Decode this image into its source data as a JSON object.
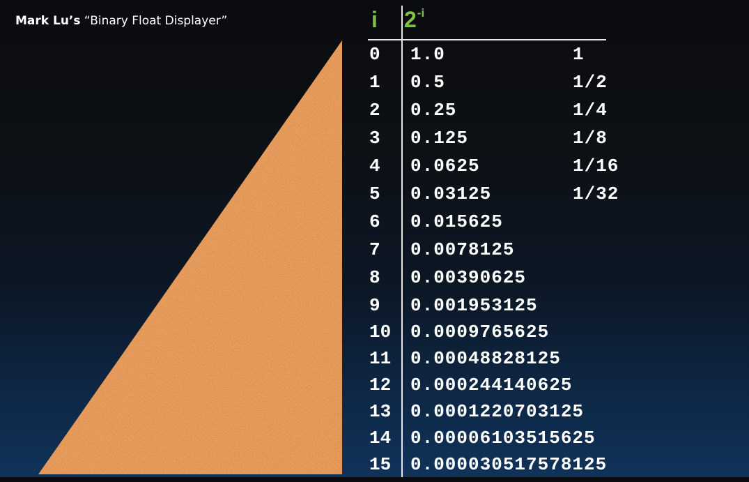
{
  "caption": {
    "author": "Mark Lu’s",
    "title": "“Binary Float Displayer”"
  },
  "table": {
    "header_index": "i",
    "header_power_base": "2",
    "header_power_exp": "-i",
    "rows": [
      {
        "i": "0",
        "value": "1.0",
        "fraction": "1"
      },
      {
        "i": "1",
        "value": "0.5",
        "fraction": "1/2"
      },
      {
        "i": "2",
        "value": "0.25",
        "fraction": "1/4"
      },
      {
        "i": "3",
        "value": "0.125",
        "fraction": "1/8"
      },
      {
        "i": "4",
        "value": "0.0625",
        "fraction": "1/16"
      },
      {
        "i": "5",
        "value": "0.03125",
        "fraction": "1/32"
      },
      {
        "i": "6",
        "value": "0.015625",
        "fraction": ""
      },
      {
        "i": "7",
        "value": "0.0078125",
        "fraction": ""
      },
      {
        "i": "8",
        "value": "0.00390625",
        "fraction": ""
      },
      {
        "i": "9",
        "value": "0.001953125",
        "fraction": ""
      },
      {
        "i": "10",
        "value": "0.0009765625",
        "fraction": ""
      },
      {
        "i": "11",
        "value": "0.00048828125",
        "fraction": ""
      },
      {
        "i": "12",
        "value": "0.000244140625",
        "fraction": ""
      },
      {
        "i": "13",
        "value": "0.0001220703125",
        "fraction": ""
      },
      {
        "i": "14",
        "value": "0.00006103515625",
        "fraction": ""
      },
      {
        "i": "15",
        "value": "0.000030517578125",
        "fraction": ""
      }
    ]
  },
  "colors": {
    "header_green": "#7dc242",
    "triangle_orange": "#c1642a",
    "text": "#ffffff"
  }
}
